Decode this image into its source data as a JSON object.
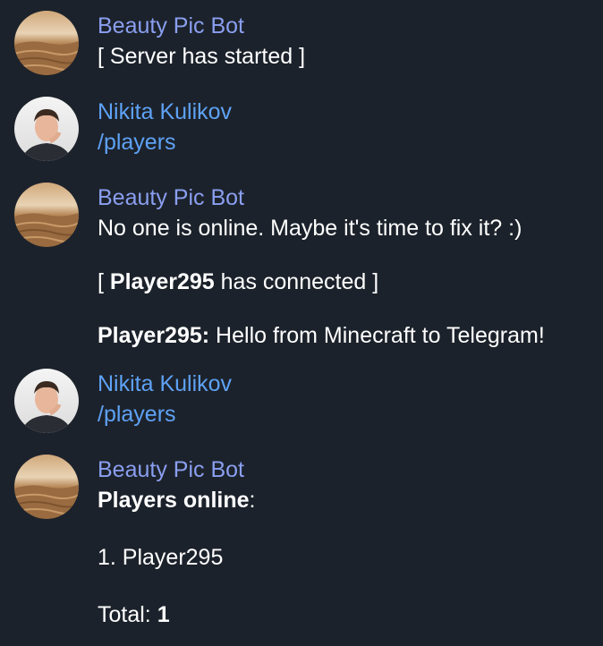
{
  "messages": [
    {
      "sender": "Beauty Pic Bot",
      "avatar": "desert-dunes-avatar",
      "text": "[ Server has started ]"
    },
    {
      "sender": "Nikita Kulikov",
      "avatar": "user-photo-avatar",
      "command": "/players"
    },
    {
      "sender": "Beauty Pic Bot",
      "avatar": "desert-dunes-avatar",
      "text": "No one is online. Maybe it's time to fix it? :)",
      "connect": {
        "open": "[ ",
        "player": "Player295",
        "rest": " has connected ]"
      },
      "chat": {
        "player": "Player295:",
        "text": " Hello from Minecraft to Telegram!"
      }
    },
    {
      "sender": "Nikita Kulikov",
      "avatar": "user-photo-avatar",
      "command": "/players"
    },
    {
      "sender": "Beauty Pic Bot",
      "avatar": "desert-dunes-avatar",
      "online_label": "Players online",
      "colon": ":",
      "list_item": "1. Player295",
      "total_label": "Total: ",
      "total_value": "1"
    }
  ],
  "colors": {
    "background": "#1c222b",
    "bot_name": "#8a9ff0",
    "user_name": "#5ea2f5",
    "command": "#5ea2f5",
    "text": "#ffffff"
  }
}
